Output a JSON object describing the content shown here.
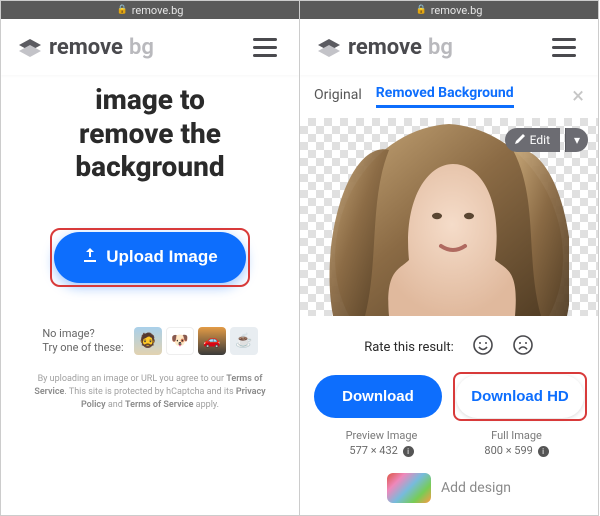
{
  "url_domain": "remove.bg",
  "logo": {
    "part1": "remove",
    "part2": "bg"
  },
  "left": {
    "headline_l1": "image to",
    "headline_l2": "remove the",
    "headline_l3": "background",
    "upload_label": "Upload Image",
    "noimage_l1": "No image?",
    "noimage_l2": "Try one of these:",
    "legal_pre": "By uploading an image or URL you agree to our ",
    "legal_tos": "Terms of Service",
    "legal_mid1": ". This site is protected by hCaptcha and its ",
    "legal_pp": "Privacy Policy",
    "legal_and": " and ",
    "legal_tos2": "Terms of Service",
    "legal_end": " apply."
  },
  "right": {
    "tab_original": "Original",
    "tab_removed": "Removed Background",
    "edit_label": "Edit",
    "rate_label": "Rate this result:",
    "download_label": "Download",
    "download_hd_label": "Download HD",
    "preview_title": "Preview Image",
    "preview_dims": "577 × 432",
    "full_title": "Full Image",
    "full_dims": "800 × 599",
    "add_design": "Add design"
  }
}
